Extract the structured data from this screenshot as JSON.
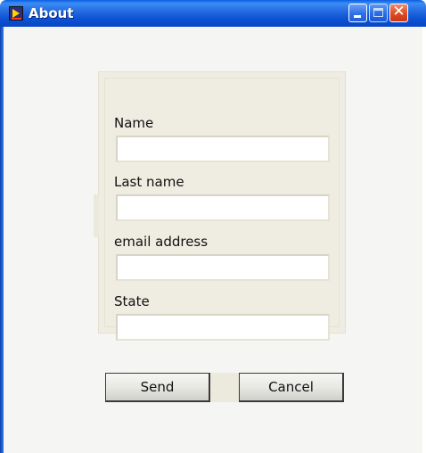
{
  "window": {
    "title": "About"
  },
  "form": {
    "fields": [
      {
        "label": "Name",
        "value": "",
        "placeholder": ""
      },
      {
        "label": "Last name",
        "value": "",
        "placeholder": ""
      },
      {
        "label": "email address",
        "value": "",
        "placeholder": ""
      },
      {
        "label": "State",
        "value": "",
        "placeholder": ""
      }
    ]
  },
  "buttons": {
    "send_label": "Send",
    "cancel_label": "Cancel"
  },
  "colors": {
    "titlebar": "#2268de",
    "panel": "#efede3",
    "close": "#de4a22"
  }
}
